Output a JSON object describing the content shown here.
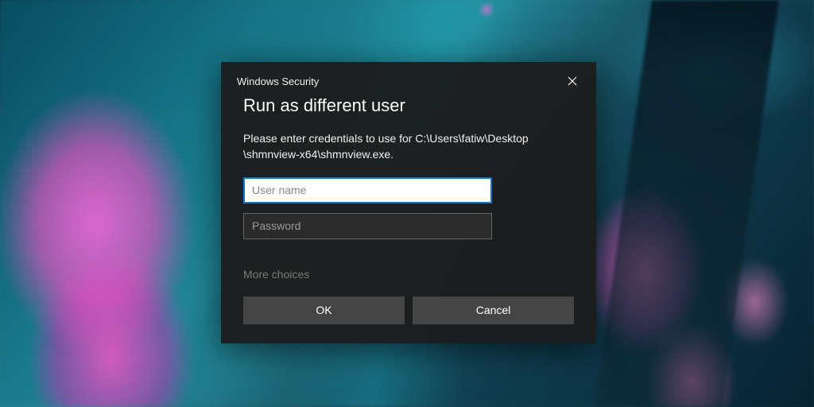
{
  "dialog": {
    "title_small": "Windows Security",
    "heading": "Run as different user",
    "message": "Please enter credentials to use for C:\\Users\\fatiw\\Desktop\n\\shmnview-x64\\shmnview.exe.",
    "username_placeholder": "User name",
    "username_value": "",
    "password_placeholder": "Password",
    "password_value": "",
    "more_choices": "More choices",
    "ok_label": "OK",
    "cancel_label": "Cancel"
  }
}
